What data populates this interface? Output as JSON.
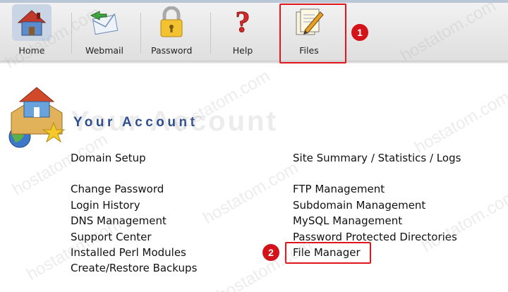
{
  "toolbar": {
    "items": [
      {
        "label": "Home",
        "icon": "house-icon"
      },
      {
        "label": "Webmail",
        "icon": "mail-icon"
      },
      {
        "label": "Password",
        "icon": "padlock-icon"
      },
      {
        "label": "Help",
        "icon": "question-mark-icon"
      },
      {
        "label": "Files",
        "icon": "files-icon"
      }
    ]
  },
  "callouts": {
    "step1": "1",
    "step2": "2"
  },
  "account": {
    "title": "Your Account",
    "left_links": [
      "Domain Setup",
      "Change Password",
      "Login History",
      "DNS Management",
      "Support Center",
      "Installed Perl Modules",
      "Create/Restore Backups"
    ],
    "right_links": [
      "Site Summary / Statistics / Logs",
      "FTP Management",
      "Subdomain Management",
      "MySQL Management",
      "Password Protected Directories",
      "File Manager"
    ]
  },
  "watermark": "hostatom.com",
  "colors": {
    "accent": "#2f4e8c",
    "highlight": "#e0161c"
  }
}
